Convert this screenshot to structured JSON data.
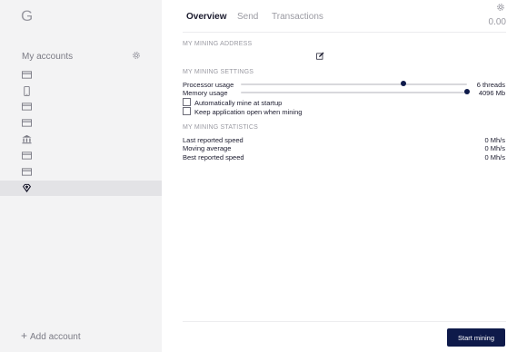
{
  "sidebar": {
    "logo": "G",
    "accounts_title": "My accounts",
    "add_account_label": "Add account",
    "accounts": [
      {
        "icon": "card-icon"
      },
      {
        "icon": "phone-icon"
      },
      {
        "icon": "card-icon"
      },
      {
        "icon": "card-icon"
      },
      {
        "icon": "bank-icon"
      },
      {
        "icon": "card-icon"
      },
      {
        "icon": "card-icon"
      },
      {
        "icon": "diamond-icon",
        "selected": true
      }
    ]
  },
  "tabs": [
    {
      "label": "Overview",
      "active": true
    },
    {
      "label": "Send",
      "active": false
    },
    {
      "label": "Transactions",
      "active": false
    }
  ],
  "balance": "0.00",
  "mining_address": {
    "title": "MY MINING ADDRESS",
    "edit_icon": "edit-icon"
  },
  "mining_settings": {
    "title": "MY MINING SETTINGS",
    "processor_label": "Processor usage",
    "processor_value": "6 threads",
    "processor_fraction": 0.72,
    "memory_label": "Memory usage",
    "memory_value": "4096 Mb",
    "memory_fraction": 1.0,
    "auto_mine_label": "Automatically mine at startup",
    "auto_mine_checked": false,
    "keep_open_label": "Keep application open when mining",
    "keep_open_checked": false
  },
  "mining_statistics": {
    "title": "MY MINING STATISTICS",
    "rows": [
      {
        "label": "Last reported speed",
        "value": "0 Mh/s"
      },
      {
        "label": "Moving average",
        "value": "0 Mh/s"
      },
      {
        "label": "Best reported speed",
        "value": "0 Mh/s"
      }
    ]
  },
  "start_button_label": "Start mining",
  "colors": {
    "sidebar_bg": "#f3f3f4",
    "selected_bg": "#e3e3e6",
    "accent": "#0e1a4a"
  }
}
